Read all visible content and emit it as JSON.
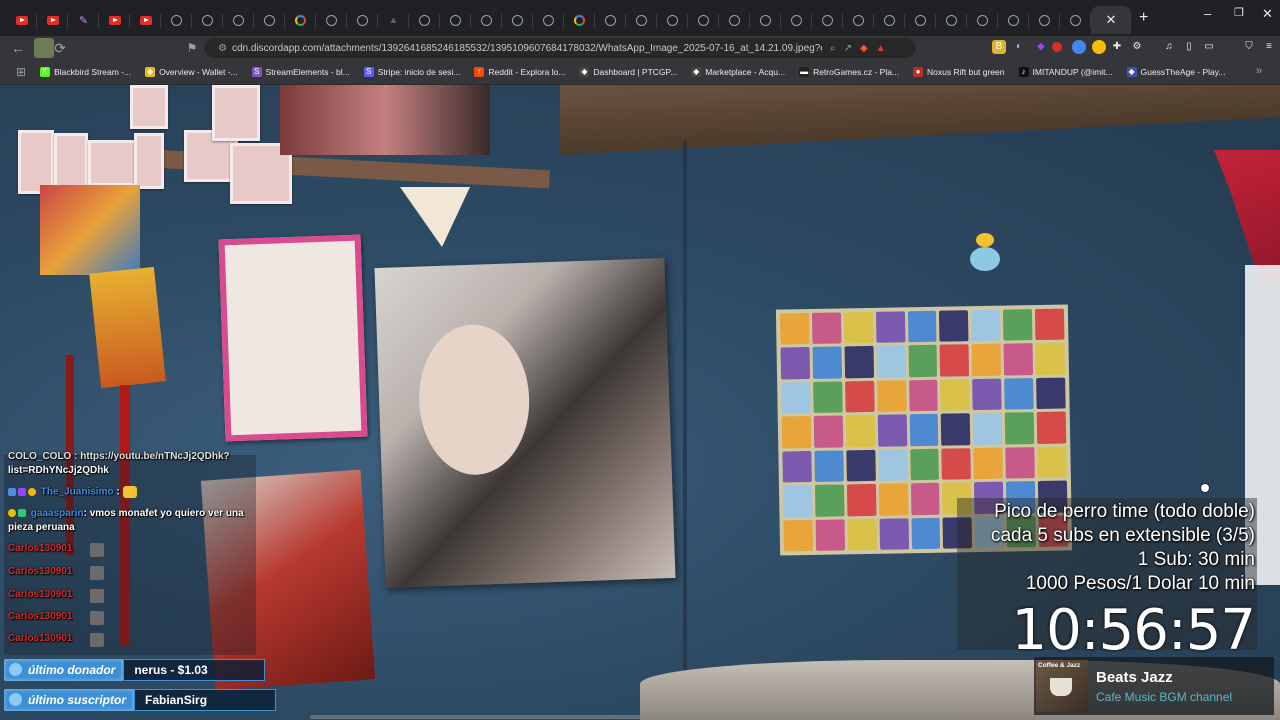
{
  "browser": {
    "tabs": [
      "yt",
      "yt",
      "feather",
      "yt",
      "yt",
      "globe",
      "globe",
      "globe",
      "globe",
      "google",
      "globe",
      "globe",
      "dim",
      "globe",
      "globe",
      "globe",
      "globe",
      "globe",
      "google",
      "globe",
      "globe",
      "globe",
      "globe",
      "globe",
      "globe",
      "globe",
      "globe",
      "globe",
      "globe",
      "globe",
      "globe",
      "globe",
      "globe",
      "globe",
      "globe"
    ],
    "active_tab_close": "✕",
    "new_tab": "+",
    "window_controls": {
      "minimize": "–",
      "maximize": "❐",
      "close": "✕"
    },
    "url": "cdn.discordapp.com/attachments/1392641685246185532/1395109607684178032/WhatsApp_Image_2025-07-16_at_14.21.09.jpeg?ex=687be...",
    "bookmarks": [
      {
        "label": "Blackbird Stream -...",
        "icon": "K",
        "color": "#53fc18"
      },
      {
        "label": "Overview - Wallet -...",
        "icon": "◆",
        "color": "#f0b90b"
      },
      {
        "label": "StreamElements - bl...",
        "icon": "S",
        "color": "#7e57c2"
      },
      {
        "label": "Stripe: inicio de sesi...",
        "icon": "S",
        "color": "#635bff"
      },
      {
        "label": "Reddit - Explora lo...",
        "icon": "r",
        "color": "#ff4500"
      },
      {
        "label": "Dashboard | PTCGP...",
        "icon": "◆",
        "color": "#444444"
      },
      {
        "label": "Marketplace - Acqu...",
        "icon": "◆",
        "color": "#444444"
      },
      {
        "label": "RetroGames.cz - Pla...",
        "icon": "▬",
        "color": "#222222"
      },
      {
        "label": "Noxus Rift but green",
        "icon": "●",
        "color": "#c62828"
      },
      {
        "label": "IMITANDUP (@imit...",
        "icon": "♪",
        "color": "#111111"
      },
      {
        "label": "GuessTheAge - Play...",
        "icon": "◆",
        "color": "#3f51b5"
      }
    ]
  },
  "stream": {
    "chat": {
      "partial_line_1": "COLO_COLO : https://youtu.be/nTNcJj2QDhk?",
      "partial_line_2": "list=RDhYNcJj2QDhk",
      "msg1_user": "The_Juanisimo",
      "msg1_sep": ":",
      "msg2_user": "gaaasparin",
      "msg2_text": ": vmos monafet yo quiero ver una",
      "msg2_text_cont": "pieza peruana",
      "repeat_users": [
        "Carlos130901",
        "Carlos130901",
        "Carlos130901",
        "Carlos130901",
        "Carlos130901"
      ]
    },
    "donor": {
      "donor_label": "último donador",
      "donor_value": "nerus - $1.03",
      "sub_label": "último suscriptor",
      "sub_value": "FabianSirg"
    },
    "info": {
      "line1": "Pico de perro time (todo doble)",
      "line2": "cada 5 subs en extensible (3/5)",
      "line3": "1 Sub: 30 min",
      "line4": "1000 Pesos/1 Dolar 10 min",
      "timer": "10:56:57"
    },
    "music": {
      "art_label": "Coffee & Jazz",
      "title": "Beats Jazz",
      "subtitle": "Cafe Music BGM channel"
    },
    "colors": {
      "accent_blue": "#3d8fd6",
      "chat_red": "#d02b2b",
      "music_teal": "#5fb6c9"
    }
  }
}
